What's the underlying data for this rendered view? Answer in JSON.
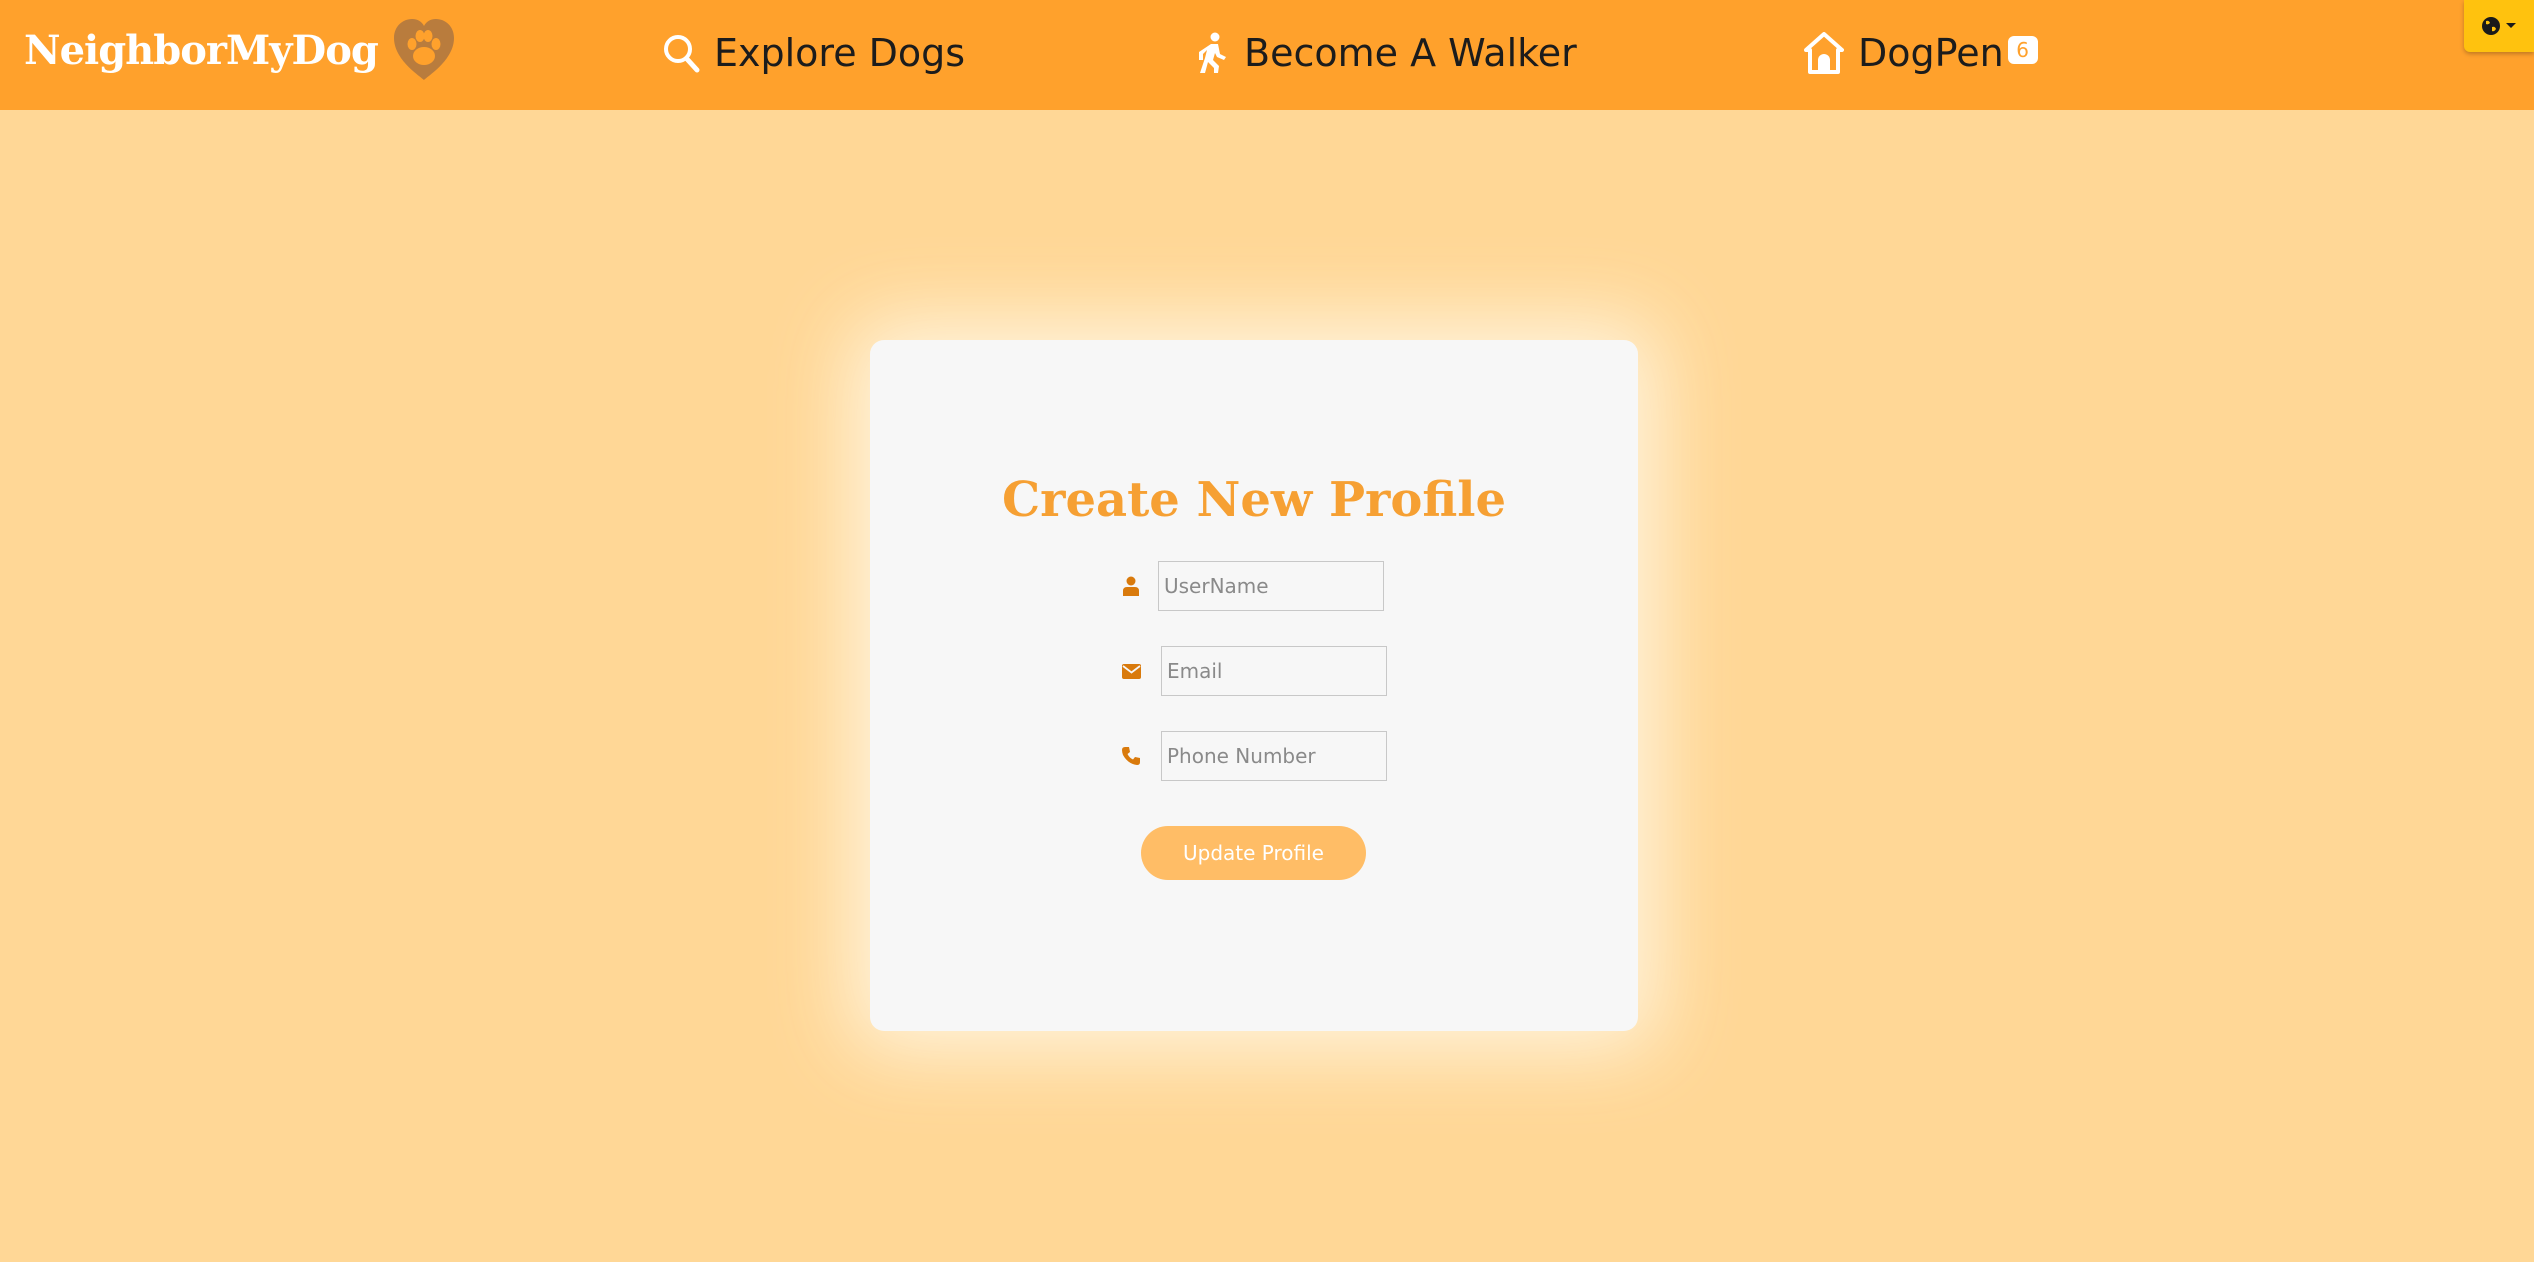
{
  "navbar": {
    "brand": "NeighborMyDog",
    "brand_logo_icon": "heart-paw-icon",
    "links": [
      {
        "label": "Explore Dogs",
        "icon": "search-icon"
      },
      {
        "label": "Become A Walker",
        "icon": "walking-person-icon"
      },
      {
        "label": "DogPen",
        "icon": "dog-house-icon",
        "badge": "6"
      }
    ],
    "language_icon": "globe-icon"
  },
  "form": {
    "title": "Create New Profile",
    "fields": [
      {
        "icon": "user-icon",
        "placeholder": "UserName",
        "value": ""
      },
      {
        "icon": "envelope-icon",
        "placeholder": "Email",
        "value": ""
      },
      {
        "icon": "phone-icon",
        "placeholder": "Phone Number",
        "value": ""
      }
    ],
    "submit_label": "Update Profile"
  },
  "colors": {
    "navbar": "#ffa12c",
    "page_background": "#ffd796",
    "card": "#f7f7f7",
    "title": "#f6a033",
    "icon": "#d97a0c",
    "button": "#ffbd66",
    "language_button": "#ffc20e"
  }
}
